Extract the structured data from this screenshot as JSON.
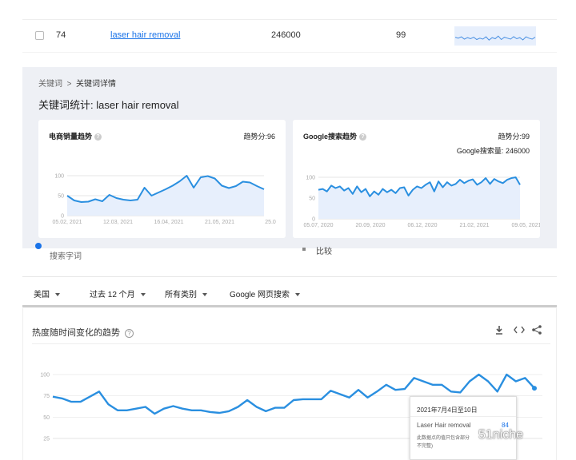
{
  "keyword_row": {
    "index": "74",
    "keyword": "laser hair removal",
    "volume": "246000",
    "score": "99",
    "spark": [
      60,
      55,
      62,
      50,
      58,
      52,
      60,
      48,
      55,
      50,
      62,
      45,
      58,
      52,
      66,
      48,
      60,
      55,
      50,
      63,
      52,
      58,
      46,
      62,
      55,
      50,
      60
    ]
  },
  "panel": {
    "breadcrumb_root": "关键词",
    "breadcrumb_sep": ">",
    "breadcrumb_current": "关键词详情",
    "title": "关键词统计: laser hair removal",
    "ecommerce": {
      "title": "电商销量趋势",
      "help": "?",
      "score_label": "趋势分:",
      "score": "96"
    },
    "google": {
      "title": "Google搜索趋势",
      "help": "?",
      "score_label": "趋势分:",
      "score": "99",
      "volume_label": "Google搜索量:",
      "volume": "246000"
    }
  },
  "under_panel": {
    "search_term": "搜索字词",
    "compare": "比较"
  },
  "filters": [
    "美国",
    "过去 12 个月",
    "所有类别",
    "Google 网页搜索"
  ],
  "trend_card": {
    "title": "热度随时间变化的趋势",
    "help": "?",
    "icons": [
      "download-icon",
      "embed-icon",
      "share-icon"
    ]
  },
  "tooltip": {
    "date": "2021年7月4日至10日",
    "term": "Laser Hair removal",
    "value": "84",
    "note_line1": "此数据点的值只包含部分",
    "note_line2": "不完整)"
  },
  "watermark": "51niche",
  "colors": {
    "line": "#2a8fe0",
    "google_line": "#4a90e2",
    "area": "#e7effc",
    "link": "#1a73e8"
  },
  "chart_data": [
    {
      "type": "line",
      "title": "电商销量趋势",
      "ylim": [
        0,
        100
      ],
      "yticks": [
        0,
        50,
        100
      ],
      "xtick_labels": [
        "05.02, 2021",
        "12.03, 2021",
        "16.04, 2021",
        "21.05, 2021",
        "25.0"
      ],
      "series": [
        {
          "values": [
            50,
            38,
            34,
            35,
            41,
            36,
            52,
            44,
            40,
            38,
            40,
            70,
            50,
            58,
            66,
            75,
            86,
            100,
            70,
            96,
            99,
            93,
            75,
            69,
            74,
            85,
            83,
            74,
            66
          ]
        }
      ]
    },
    {
      "type": "line",
      "title": "Google搜索趋势",
      "ylim": [
        0,
        100
      ],
      "yticks": [
        0,
        50,
        100
      ],
      "xtick_labels": [
        "05.07, 2020",
        "20.09, 2020",
        "06.12, 2020",
        "21.02, 2021",
        "09.05, 2021"
      ],
      "series": [
        {
          "values": [
            70,
            72,
            66,
            80,
            74,
            78,
            68,
            74,
            60,
            78,
            64,
            72,
            54,
            66,
            58,
            72,
            64,
            70,
            62,
            74,
            76,
            56,
            70,
            78,
            74,
            82,
            88,
            66,
            90,
            76,
            88,
            80,
            84,
            94,
            86,
            92,
            95,
            82,
            88,
            98,
            84,
            96,
            90,
            86,
            94,
            98,
            100,
            82
          ]
        }
      ]
    },
    {
      "type": "line",
      "title": "",
      "ylim": [
        25,
        100
      ],
      "yticks": [
        25,
        50,
        75,
        100
      ],
      "series": [
        {
          "values": [
            74,
            72,
            68,
            68,
            74,
            80,
            65,
            58,
            58,
            60,
            62,
            54,
            60,
            63,
            60,
            58,
            58,
            56,
            55,
            57,
            62,
            70,
            62,
            57,
            61,
            61,
            70,
            71,
            71,
            71,
            81,
            77,
            73,
            82,
            73,
            80,
            88,
            82,
            83,
            96,
            92,
            88,
            88,
            80,
            79,
            92,
            100,
            92,
            80,
            100,
            92,
            96,
            84
          ]
        }
      ]
    }
  ]
}
